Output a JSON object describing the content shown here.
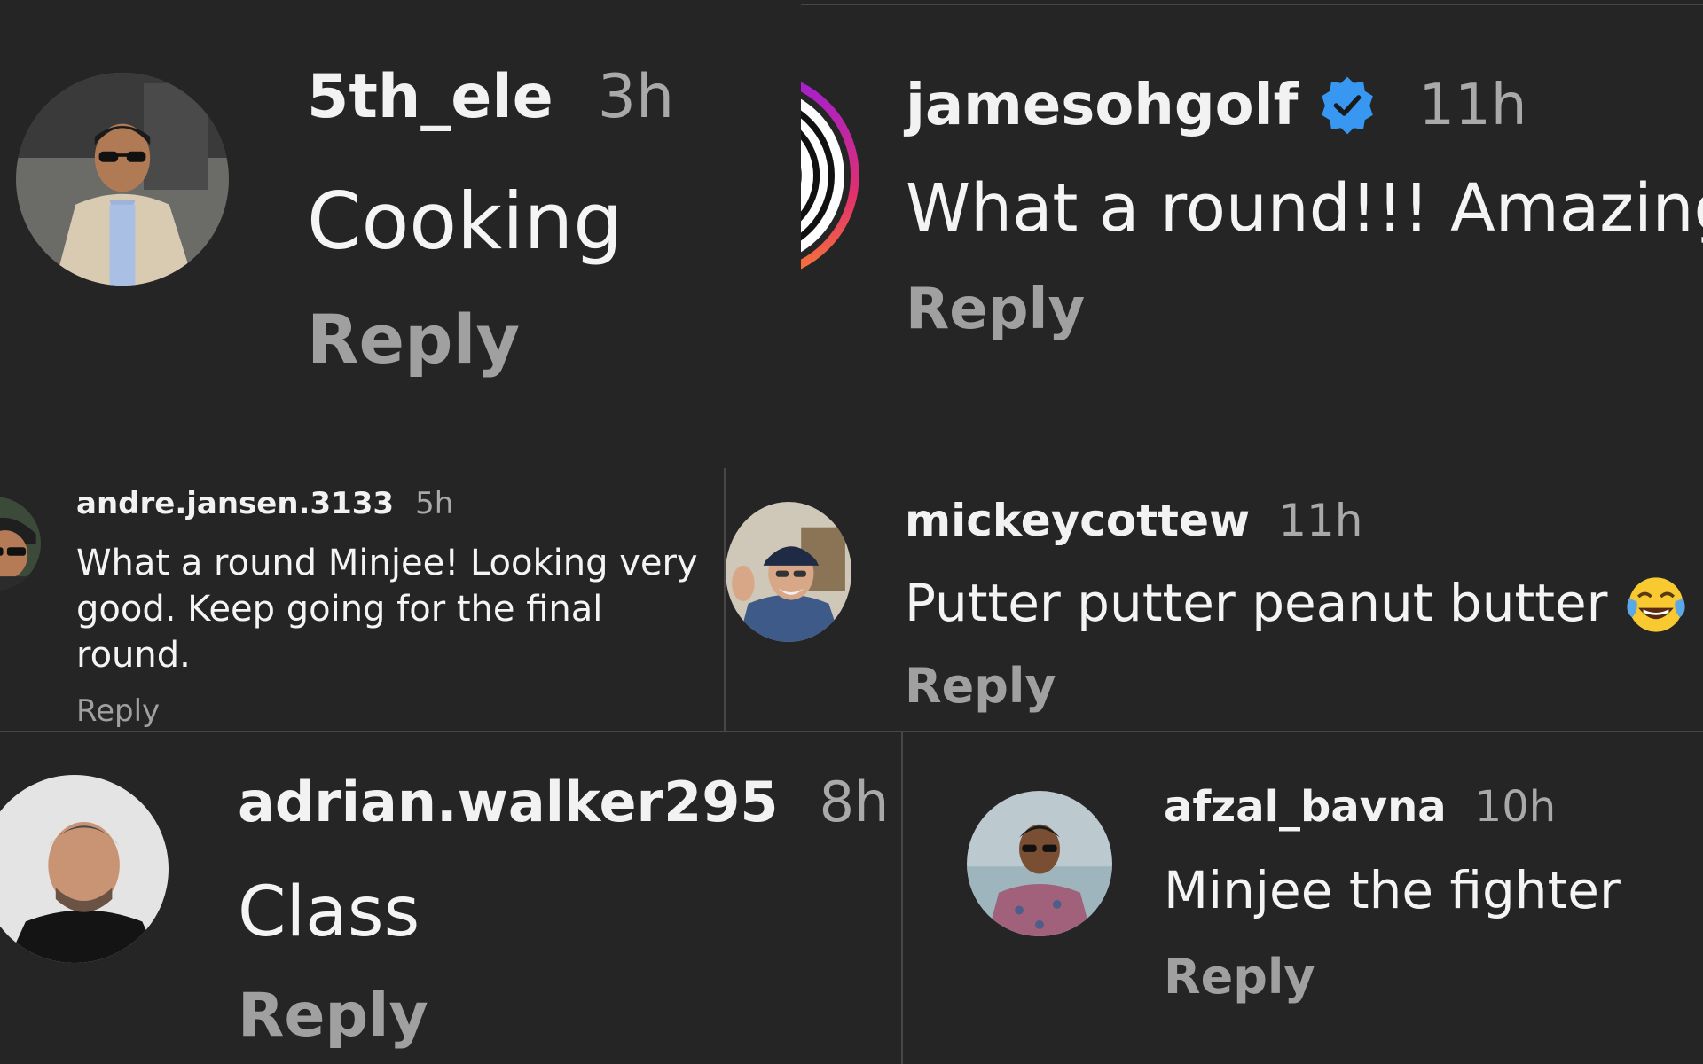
{
  "colors": {
    "background": "#252525",
    "divider": "#474747",
    "username": "#f2f2f2",
    "timestamp": "#a9a9a9",
    "comment_text": "#f4f4f4",
    "reply": "#a0a0a0",
    "verified_badge": "#3897f0"
  },
  "comments": [
    {
      "username": "5th_ele",
      "time": "3h",
      "text": "Cooking",
      "reply_label": "Reply",
      "avatar_icon": "user-photo-avatar"
    },
    {
      "username": "jamesohgolf",
      "time": "11h",
      "text": "What a round!!! Amazing!",
      "reply_label": "Reply",
      "verified": true,
      "avatar_icon": "story-ring-avatar"
    },
    {
      "username": "andre.jansen.3133",
      "time": "5h",
      "text_lines": [
        "What a round Minjee!  Looking very",
        "good.  Keep going for the final",
        "round."
      ],
      "reply_label": "Reply",
      "avatar_icon": "user-photo-avatar"
    },
    {
      "username": "mickeycottew",
      "time": "11h",
      "text": "Putter putter peanut butter",
      "emoji": "laughing-tears-emoji",
      "reply_label": "Reply",
      "avatar_icon": "user-photo-avatar"
    },
    {
      "username": "adrian.walker295",
      "time": "8h",
      "text": "Class",
      "reply_label": "Reply",
      "avatar_icon": "user-photo-avatar"
    },
    {
      "username": "afzal_bavna",
      "time": "10h",
      "text": "Minjee the fighter",
      "reply_label": "Reply",
      "avatar_icon": "user-photo-avatar"
    }
  ]
}
